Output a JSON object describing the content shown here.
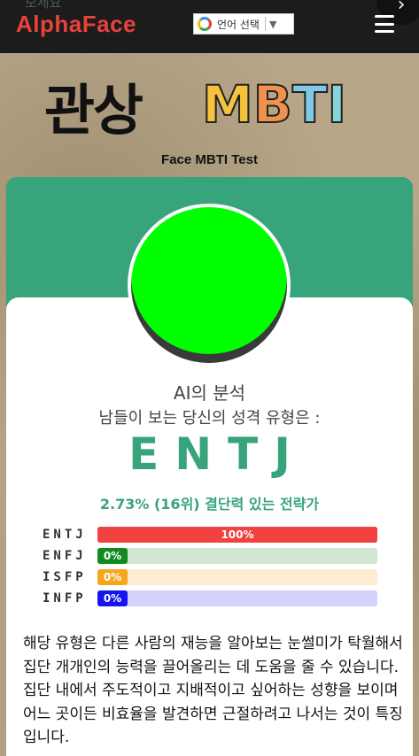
{
  "header": {
    "ghost_text": "보세요",
    "logo": "AlphaFace",
    "translate_label": "언어 선택",
    "translate_arrow": "▼"
  },
  "title": {
    "korean": "관상",
    "mbti_letters": [
      "M",
      "B",
      "T",
      "I"
    ],
    "mbti_colors": [
      "#f5c23c",
      "#f0914d",
      "#7fc8e8",
      "#86d3d8"
    ],
    "subtitle": "Face MBTI Test"
  },
  "result": {
    "heading": "AI의 분석",
    "subheading": "남들이 보는 당신의 성격 유형은 :",
    "type": "ENTJ",
    "rank_line": "2.73% (16위) 결단력 있는 전략가"
  },
  "bars": [
    {
      "label": "ENTJ",
      "value_text": "100%",
      "fraction": 1.0,
      "fill": "#f0433f",
      "track": "#f0433f"
    },
    {
      "label": "ENFJ",
      "value_text": "0%",
      "fraction": 0.0,
      "fill": "#118a1e",
      "track": "#cfe6d0"
    },
    {
      "label": "ISFP",
      "value_text": "0%",
      "fraction": 0.0,
      "fill": "#f7a61c",
      "track": "#fdecd0"
    },
    {
      "label": "INFP",
      "value_text": "0%",
      "fraction": 0.0,
      "fill": "#1515f0",
      "track": "#d2d2fb"
    }
  ],
  "description": "해당 유형은 다른 사람의 재능을 알아보는 눈썰미가 탁월해서 집단 개개인의 능력을 끌어올리는 데 도움을 줄 수 있습니다. 집단 내에서 주도적이고 지배적이고 싶어하는 성향을 보이며 어느 곳이든 비효율을 발견하면 근절하려고 나서는 것이 특징입니다.",
  "colors": {
    "accent": "#37a47b",
    "logo": "#e8423b",
    "topbar": "#1c1c1c"
  }
}
